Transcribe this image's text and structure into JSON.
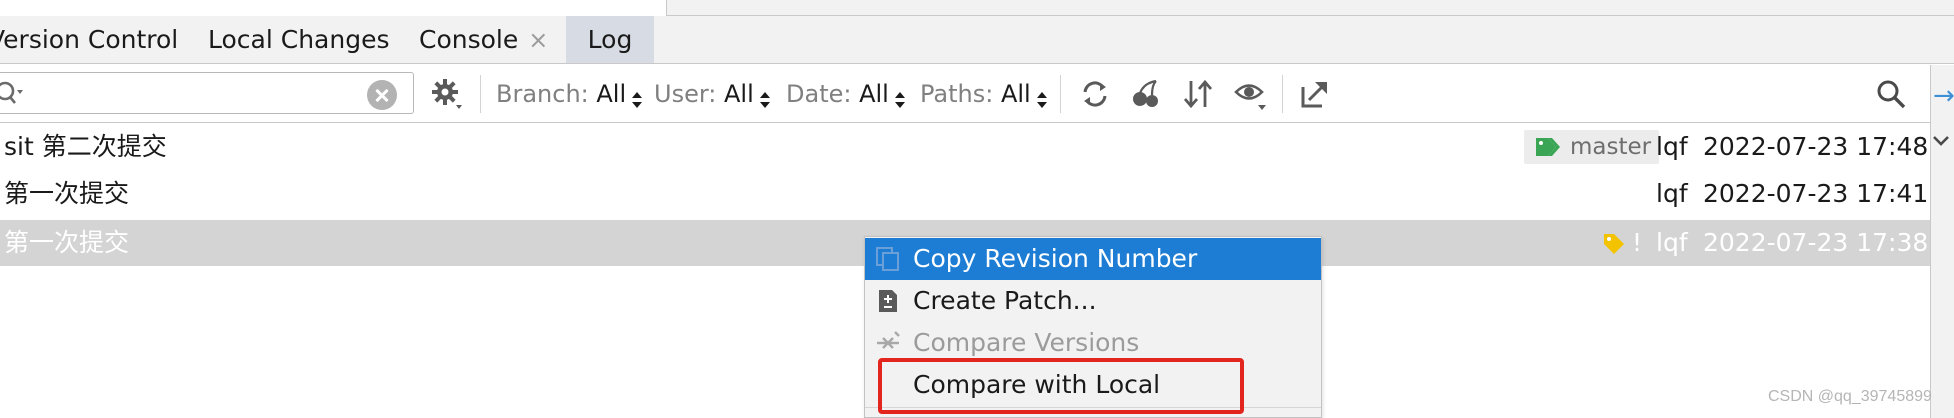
{
  "tabs": {
    "prefix_label": "Version Control:",
    "items": [
      {
        "label": "Local Changes"
      },
      {
        "label": "Console",
        "close": "×"
      },
      {
        "label": "Log",
        "active": true
      }
    ]
  },
  "toolbar": {
    "search_value": "",
    "filters": {
      "branch": {
        "label": "Branch:",
        "value": "All"
      },
      "user": {
        "label": "User:",
        "value": "All"
      },
      "date": {
        "label": "Date:",
        "value": "All"
      },
      "paths": {
        "label": "Paths:",
        "value": "All"
      }
    },
    "icons": [
      "settings-icon",
      "refresh-icon",
      "cherry-pick-icon",
      "sort-icon",
      "eye-icon",
      "export-icon",
      "search-icon"
    ]
  },
  "commits": [
    {
      "message": "sit 第二次提交",
      "branch": "master",
      "author": "lqf",
      "date": "2022-07-23 17:48"
    },
    {
      "message": "第一次提交",
      "author": "lqf",
      "date": "2022-07-23 17:41"
    },
    {
      "message": "第一次提交",
      "marker": "!",
      "author": "lqf",
      "date": "2022-07-23 17:38",
      "selected": true
    }
  ],
  "context_menu": {
    "items": [
      {
        "label": "Copy Revision Number",
        "active": true
      },
      {
        "label": "Create Patch..."
      },
      {
        "label": "Compare Versions",
        "disabled": true
      },
      {
        "label": "Compare with Local",
        "highlighted": true
      }
    ]
  },
  "colors": {
    "accent": "#1d7dd4",
    "selected_row": "#d4d4d4",
    "branch_tag_green": "#3aa655",
    "tag_yellow": "#f4c300",
    "highlight_red": "#e3261d"
  },
  "watermark": "CSDN @qq_39745899"
}
